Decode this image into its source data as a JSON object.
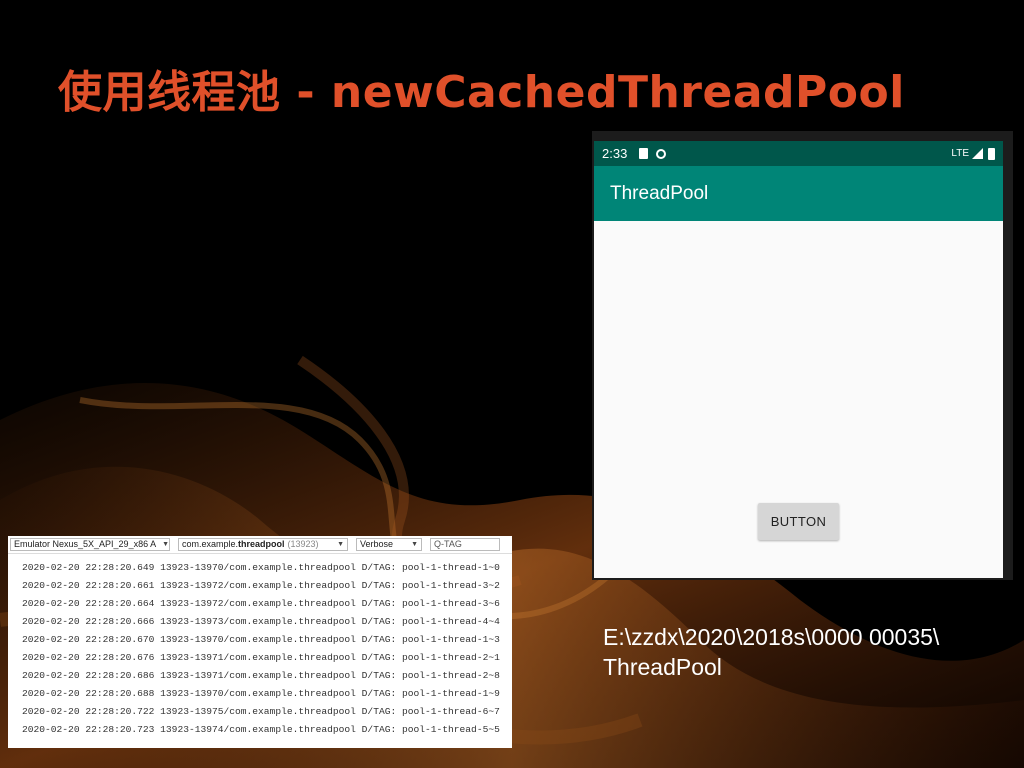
{
  "slide": {
    "title": "使用线程池 - newCachedThreadPool",
    "path_caption_line1": "E:\\zzdx\\2020\\2018s\\0000 00035\\",
    "path_caption_line2": "ThreadPool"
  },
  "phone": {
    "status_time": "2:33",
    "status_network": "LTE",
    "app_title": "ThreadPool",
    "button_label": "BUTTON",
    "colors": {
      "status_bar": "#00574b",
      "app_bar": "#008577"
    }
  },
  "logcat": {
    "device": "Emulator Nexus_5X_API_29_x86 A",
    "process_prefix": "com.example.",
    "process_bold": "threadpool",
    "process_pid": "(13923)",
    "level": "Verbose",
    "search_placeholder": "Q-TAG",
    "lines": [
      "2020-02-20 22:28:20.649 13923-13970/com.example.threadpool D/TAG: pool-1-thread-1~0",
      "2020-02-20 22:28:20.661 13923-13972/com.example.threadpool D/TAG: pool-1-thread-3~2",
      "2020-02-20 22:28:20.664 13923-13972/com.example.threadpool D/TAG: pool-1-thread-3~6",
      "2020-02-20 22:28:20.666 13923-13973/com.example.threadpool D/TAG: pool-1-thread-4~4",
      "2020-02-20 22:28:20.670 13923-13970/com.example.threadpool D/TAG: pool-1-thread-1~3",
      "2020-02-20 22:28:20.676 13923-13971/com.example.threadpool D/TAG: pool-1-thread-2~1",
      "2020-02-20 22:28:20.686 13923-13971/com.example.threadpool D/TAG: pool-1-thread-2~8",
      "2020-02-20 22:28:20.688 13923-13970/com.example.threadpool D/TAG: pool-1-thread-1~9",
      "2020-02-20 22:28:20.722 13923-13975/com.example.threadpool D/TAG: pool-1-thread-6~7",
      "2020-02-20 22:28:20.723 13923-13974/com.example.threadpool D/TAG: pool-1-thread-5~5"
    ]
  }
}
